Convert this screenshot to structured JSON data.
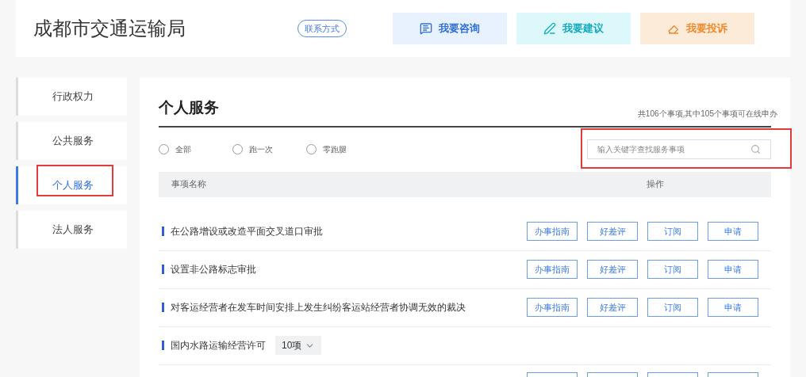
{
  "header": {
    "title": "成都市交通运输局",
    "contact": "联系方式",
    "actions": [
      {
        "kind": "consult",
        "label": "我要咨询"
      },
      {
        "kind": "suggest",
        "label": "我要建议"
      },
      {
        "kind": "complain",
        "label": "我要投诉"
      }
    ]
  },
  "sidebar": {
    "items": [
      {
        "label": "行政权力",
        "selected": false,
        "highlighted": false
      },
      {
        "label": "公共服务",
        "selected": false,
        "highlighted": false
      },
      {
        "label": "个人服务",
        "selected": true,
        "highlighted": true
      },
      {
        "label": "法人服务",
        "selected": false,
        "highlighted": false
      }
    ]
  },
  "main": {
    "title": "个人服务",
    "summary": "共106个事项,其中105个事项可在线申办",
    "filters": [
      {
        "label": "全部",
        "selected": false
      },
      {
        "label": "跑一次",
        "selected": false
      },
      {
        "label": "零跑腿",
        "selected": false
      }
    ],
    "search": {
      "placeholder": "输入关键字查找服务事项",
      "highlighted": true
    },
    "table": {
      "columns": [
        "事项名称",
        "操作"
      ],
      "rows": [
        {
          "kind": "item",
          "name": "在公路增设或改造平面交叉道口审批",
          "buttons": [
            "办事指南",
            "好差评",
            "订阅",
            "申请"
          ]
        },
        {
          "kind": "item",
          "name": "设置非公路标志审批",
          "buttons": [
            "办事指南",
            "好差评",
            "订阅",
            "申请"
          ]
        },
        {
          "kind": "item",
          "name": "对客运经营者在发车时间安排上发生纠纷客运站经营者协调无效的裁决",
          "buttons": [
            "办事指南",
            "好差评",
            "订阅",
            "申请"
          ]
        },
        {
          "kind": "group",
          "name": "国内水路运输经营许可",
          "count": "10项",
          "expanded": false
        },
        {
          "kind": "cut"
        }
      ]
    }
  }
}
